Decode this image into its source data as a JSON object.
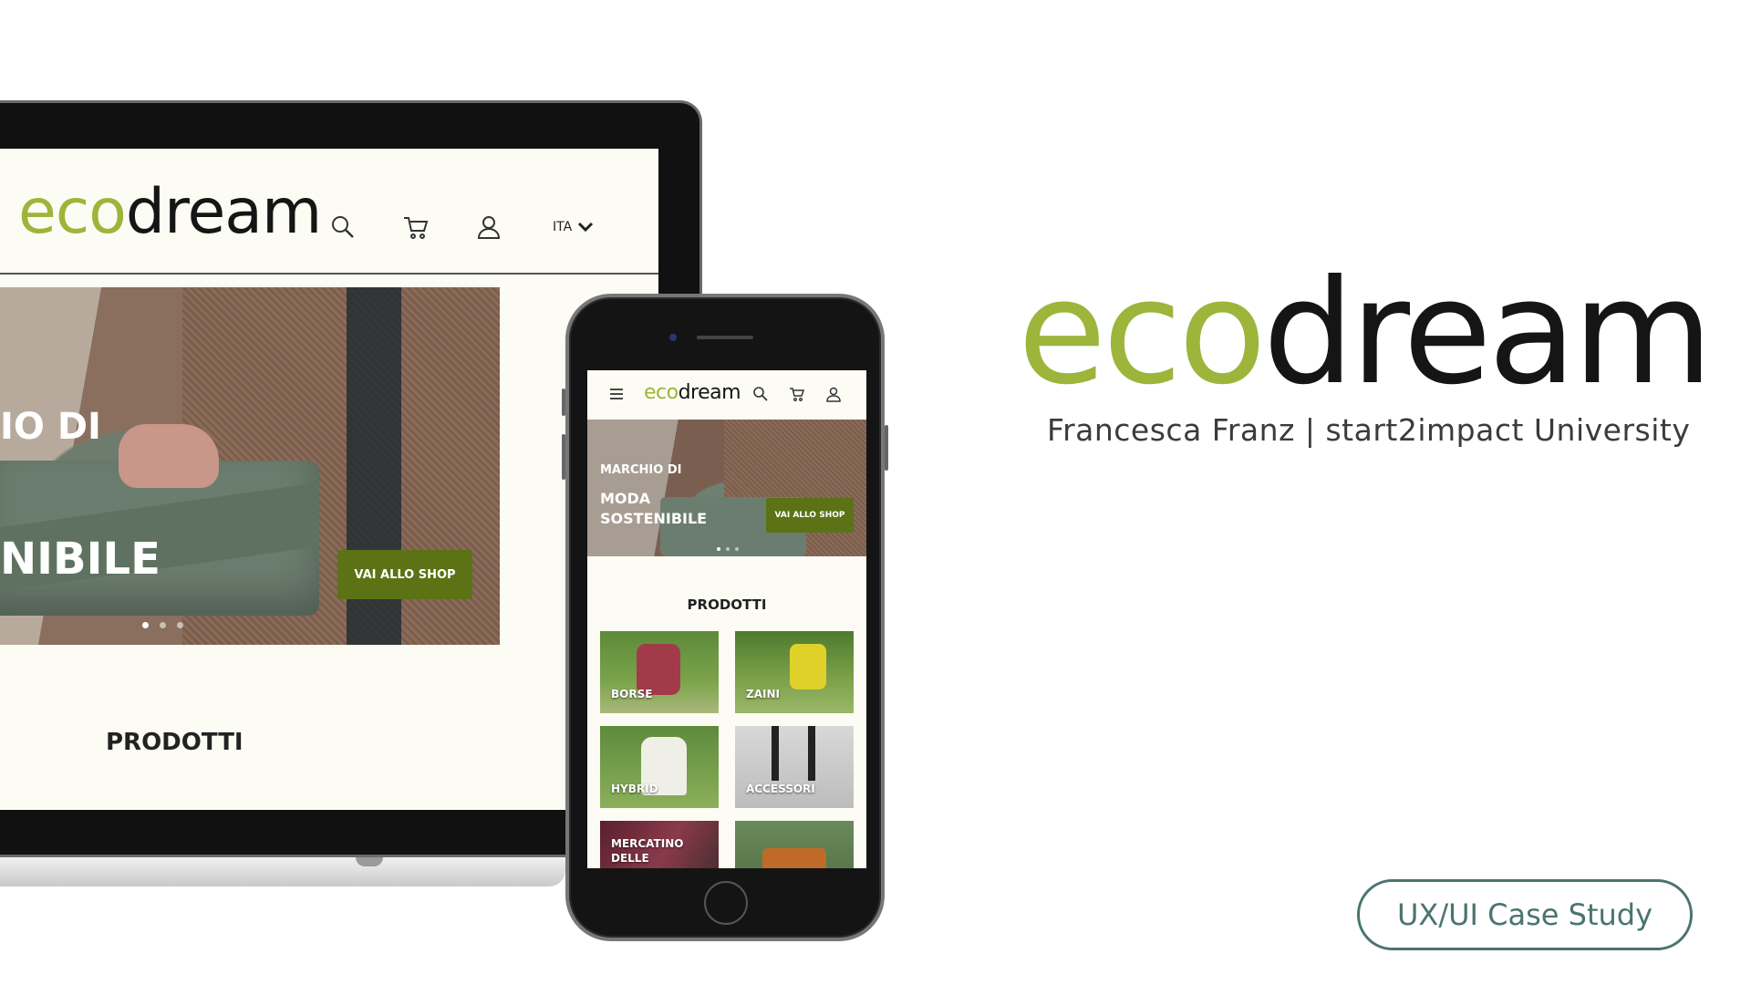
{
  "colors": {
    "brand_green": "#9db53a",
    "brand_dark": "#151515",
    "cta_green": "#5b7315",
    "case_study_teal": "#4a7470"
  },
  "laptop": {
    "logo": {
      "part1": "eco",
      "part2": "dream"
    },
    "lang": "ITA",
    "icons": [
      "search-icon",
      "cart-icon",
      "user-icon",
      "chevron-down-icon"
    ],
    "hero": {
      "text_line1": "IO DI",
      "text_line2": "NIBILE",
      "cta": "VAI ALLO SHOP"
    },
    "products_title": "PRODOTTI"
  },
  "phone": {
    "logo": {
      "part1": "eco",
      "part2": "dream"
    },
    "icons": [
      "menu-icon",
      "search-icon",
      "cart-icon",
      "user-icon"
    ],
    "hero": {
      "line1": "MARCHIO DI",
      "line2": "MODA SOSTENIBILE",
      "cta": "VAI ALLO SHOP"
    },
    "products_title": "PRODOTTI",
    "categories": [
      {
        "label": "BORSE"
      },
      {
        "label": "ZAINI"
      },
      {
        "label": "HYBRID"
      },
      {
        "label": "ACCESSORI"
      },
      {
        "label": "MERCATINO DELLE"
      },
      {
        "label": ""
      }
    ]
  },
  "brand": {
    "logo": {
      "part1": "eco",
      "part2": "dream"
    },
    "subtitle": "Francesca Franz | start2impact University",
    "case_study_button": "UX/UI Case Study"
  }
}
